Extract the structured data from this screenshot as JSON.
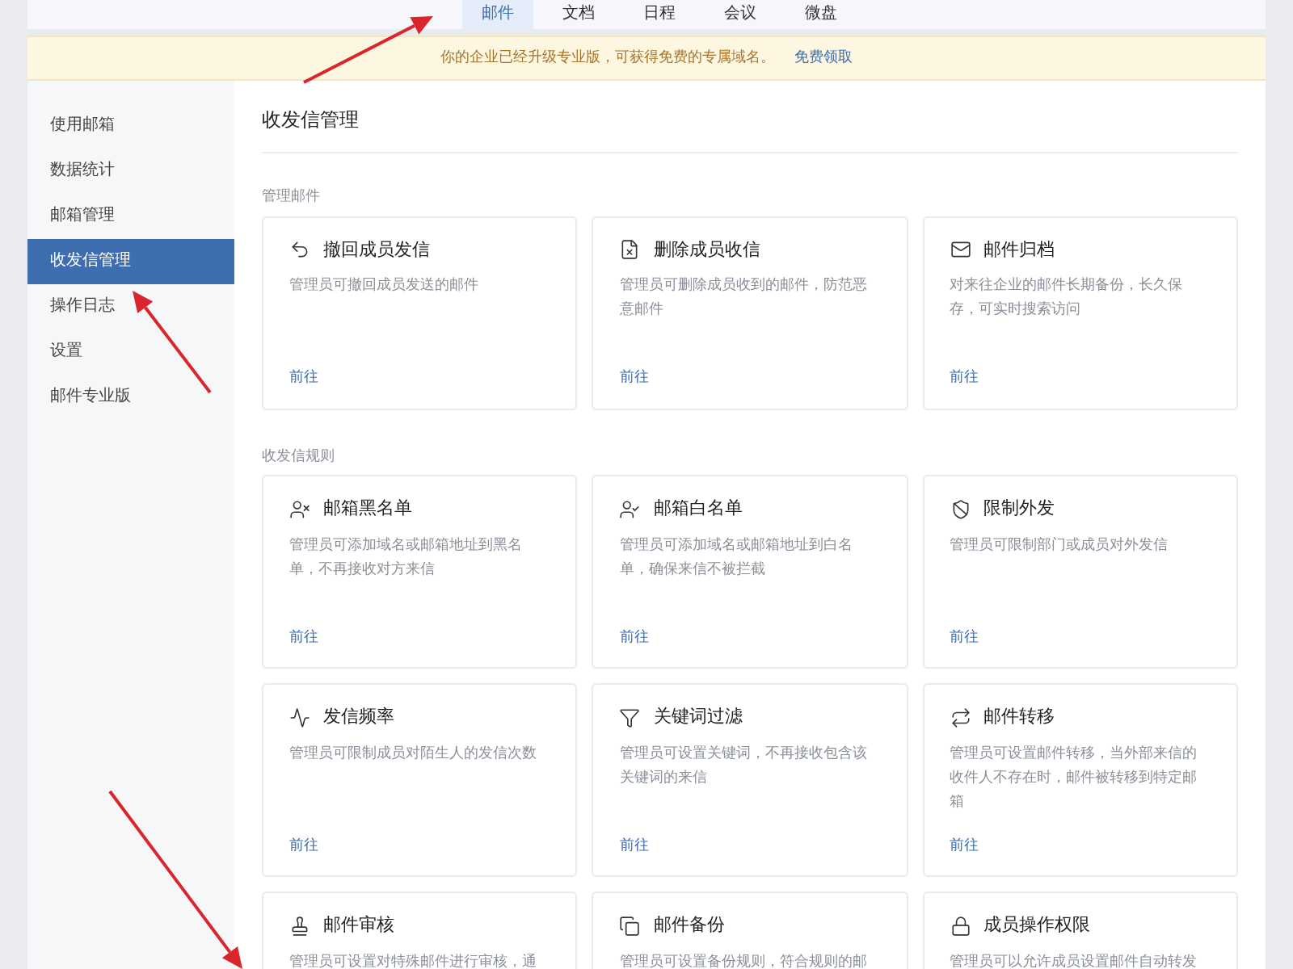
{
  "nav_tabs": [
    {
      "label": "邮件",
      "selected": true
    },
    {
      "label": "文档",
      "selected": false
    },
    {
      "label": "日程",
      "selected": false
    },
    {
      "label": "会议",
      "selected": false
    },
    {
      "label": "微盘",
      "selected": false
    }
  ],
  "banner": {
    "text": "你的企业已经升级专业版，可获得免费的专属域名。",
    "link": "免费领取"
  },
  "sidebar": {
    "items": [
      {
        "label": "使用邮箱",
        "selected": false
      },
      {
        "label": "数据统计",
        "selected": false
      },
      {
        "label": "邮箱管理",
        "selected": false
      },
      {
        "label": "收发信管理",
        "selected": true
      },
      {
        "label": "操作日志",
        "selected": false
      },
      {
        "label": "设置",
        "selected": false
      },
      {
        "label": "邮件专业版",
        "selected": false
      }
    ]
  },
  "page_title": "收发信管理",
  "sections": [
    {
      "title": "管理邮件",
      "cards": [
        {
          "title": "撤回成员发信",
          "description": "管理员可撤回成员发送的邮件",
          "link": "前往"
        },
        {
          "title": "删除成员收信",
          "description": "管理员可删除成员收到的邮件，防范恶意邮件",
          "link": "前往"
        },
        {
          "title": "邮件归档",
          "description": "对来往企业的邮件长期备份，长久保存，可实时搜索访问",
          "link": "前往"
        }
      ]
    },
    {
      "title": "收发信规则",
      "cards": [
        {
          "title": "邮箱黑名单",
          "description": "管理员可添加域名或邮箱地址到黑名单，不再接收对方来信",
          "link": "前往"
        },
        {
          "title": "邮箱白名单",
          "description": "管理员可添加域名或邮箱地址到白名单，确保来信不被拦截",
          "link": "前往"
        },
        {
          "title": "限制外发",
          "description": "管理员可限制部门或成员对外发信",
          "link": "前往"
        },
        {
          "title": "发信频率",
          "description": "管理员可限制成员对陌生人的发信次数",
          "link": "前往"
        },
        {
          "title": "关键词过滤",
          "description": "管理员可设置关键词，不再接收包含该关键词的来信",
          "link": "前往"
        },
        {
          "title": "邮件转移",
          "description": "管理员可设置邮件转移，当外部来信的收件人不存在时，邮件被转移到特定邮箱",
          "link": "前往"
        },
        {
          "title": "邮件审核",
          "description": "管理员可设置对特殊邮件进行审核，通"
        },
        {
          "title": "邮件备份",
          "description": "管理员可设置备份规则，符合规则的邮"
        },
        {
          "title": "成员操作权限",
          "description": "管理员可以允许成员设置邮件自动转发"
        }
      ]
    }
  ],
  "annotations": [
    {
      "kind": "arrow"
    },
    {
      "kind": "arrow"
    },
    {
      "kind": "arrow"
    }
  ]
}
